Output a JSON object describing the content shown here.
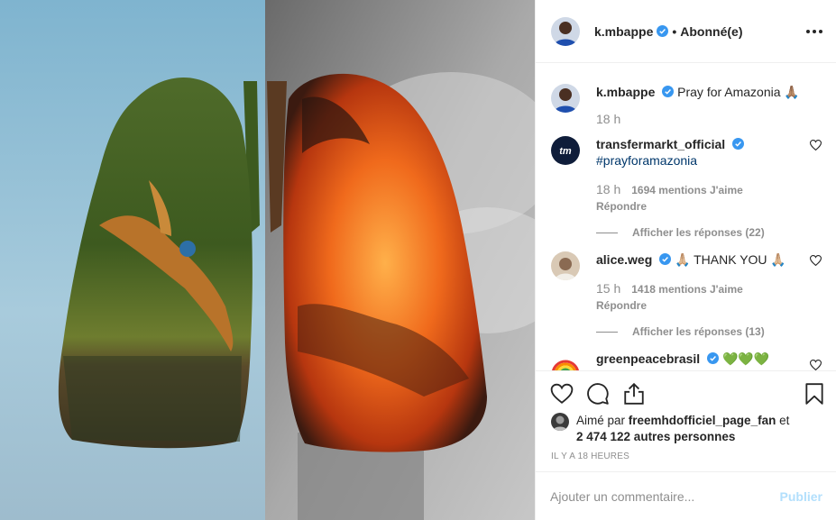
{
  "post": {
    "author": "k.mbappe",
    "separator": "•",
    "follow_status": "Abonné(e)",
    "more_icon": "more-horizontal-icon"
  },
  "caption": {
    "user": "k.mbappe",
    "text": "Pray for Amazonia 🙏🏽",
    "time": "18 h"
  },
  "comments": [
    {
      "user": "transfermarkt_official",
      "text": "",
      "hashtag": "#prayforamazonia",
      "time": "18 h",
      "likes": "1694 mentions J'aime",
      "reply": "Répondre",
      "view_replies": "Afficher les réponses (22)"
    },
    {
      "user": "alice.weg",
      "text": "🙏🏼 THANK YOU 🙏🏼",
      "time": "15 h",
      "likes": "1418 mentions J'aime",
      "reply": "Répondre",
      "view_replies": "Afficher les réponses (13)"
    },
    {
      "user": "greenpeacebrasil",
      "text": "💚💚💚"
    }
  ],
  "actions": {
    "like_icon": "heart-icon",
    "comment_icon": "comment-icon",
    "share_icon": "share-icon",
    "save_icon": "bookmark-icon"
  },
  "likes": {
    "prefix": "Aimé par ",
    "user": "freemhdofficiel_page_fan",
    "suffix": " et",
    "count_text": "2 474 122 autres personnes"
  },
  "timestamp": "IL Y A 18 HEURES",
  "add_comment": {
    "placeholder": "Ajouter un commentaire...",
    "publish": "Publier"
  },
  "colors": {
    "verified": "#3897f0",
    "hashtag": "#00376b",
    "secondary_text": "#8e8e8e",
    "publish_disabled": "#b2dffc"
  }
}
